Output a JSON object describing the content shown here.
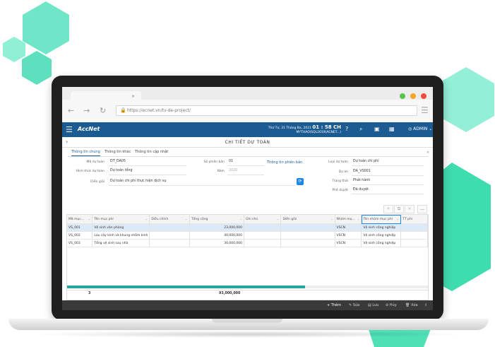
{
  "colors": {
    "brand": "#1b5b92",
    "accent_hex": "#6ee3c0",
    "teal": "#26a69a"
  },
  "browser": {
    "url": "https://ecnet.vn/tv-de-project/",
    "nav_back": "←",
    "nav_forward": "→",
    "nav_reload": "↻"
  },
  "app": {
    "logo": "AccNet",
    "logo_sup": "",
    "date_line": "Thứ Tư, 31 Tháng Ba, 2021",
    "clock": "01 : 58 CH",
    "db_line": "MYTHAO\\SQL2019(ACNET...)",
    "user": "ADMIN"
  },
  "page": {
    "title": "CHI TIẾT DỰ TOÁN"
  },
  "form_tabs": [
    {
      "label": "Thông tin chung"
    },
    {
      "label": "Thông tin khác"
    },
    {
      "label": "Thông tin cập nhật"
    }
  ],
  "form": {
    "ma_du_toan_label": "Mã dự toán",
    "ma_du_toan": "DT_DA05",
    "hinh_thuc_label": "Hình thức dự toán",
    "hinh_thuc": "Dự toán tổng",
    "dien_giai_label": "Diễn giải",
    "dien_giai": "Dự toán chi phí thực hiện dịch vụ",
    "so_phien_ban_label": "Số phiên bản",
    "so_phien_ban": "01",
    "nam_label": "Năm",
    "nam": "2020",
    "phien_ban_link": "Thông tin phiên bản",
    "loai_du_toan_label": "Loại dự toán",
    "loai_du_toan": "Dự toán chi phí",
    "du_an_label": "Dự án",
    "du_an": "DA_VS001",
    "trang_thai_label": "Trạng thái",
    "trang_thai": "Phát hành",
    "phe_duyet_label": "Phê duyệt",
    "phe_duyet": "Đã duyệt"
  },
  "grid": {
    "columns": [
      "Mã mục...",
      "Tên mục phí",
      "Diễu chỉnh",
      "Tổng cộng",
      "Ghi chú",
      "Diễn giải",
      "Nhóm mụ...",
      "Tên nhóm mục phí",
      "TT phí"
    ],
    "rows": [
      [
        "VS_001",
        "Vệ sinh văn phòng",
        "",
        "23,000,000",
        "",
        "",
        "VSCN",
        "Vệ sinh công nghiệp",
        ""
      ],
      [
        "VS_002",
        "Lau cây kính và khung nhôm kính",
        "",
        "40,000,000",
        "",
        "",
        "VSCN",
        "Vệ sinh công nghiệp",
        ""
      ],
      [
        "VS_003",
        "Tổng vệ sinh sau nhà",
        "",
        "30,000,000",
        "",
        "",
        "VSCN",
        "Vệ sinh công nghiệp",
        ""
      ]
    ],
    "footer_count": "3",
    "footer_total": "93,000,000",
    "scroll_fraction": 0.66
  },
  "actions": {
    "add": "Thêm",
    "edit": "Sửa",
    "save": "Lưu",
    "cancel": "Hủy",
    "delete": "Xóa"
  },
  "icons": {
    "lock": "🔒",
    "hamburger": "☰",
    "back": "›",
    "refresh": "⟳",
    "search": "⌕",
    "home": "⌂",
    "chart": "▦",
    "user": "👤",
    "plus": "+",
    "copy": "⧉",
    "trash": "🗑",
    "more": "…",
    "export": "⇪"
  }
}
